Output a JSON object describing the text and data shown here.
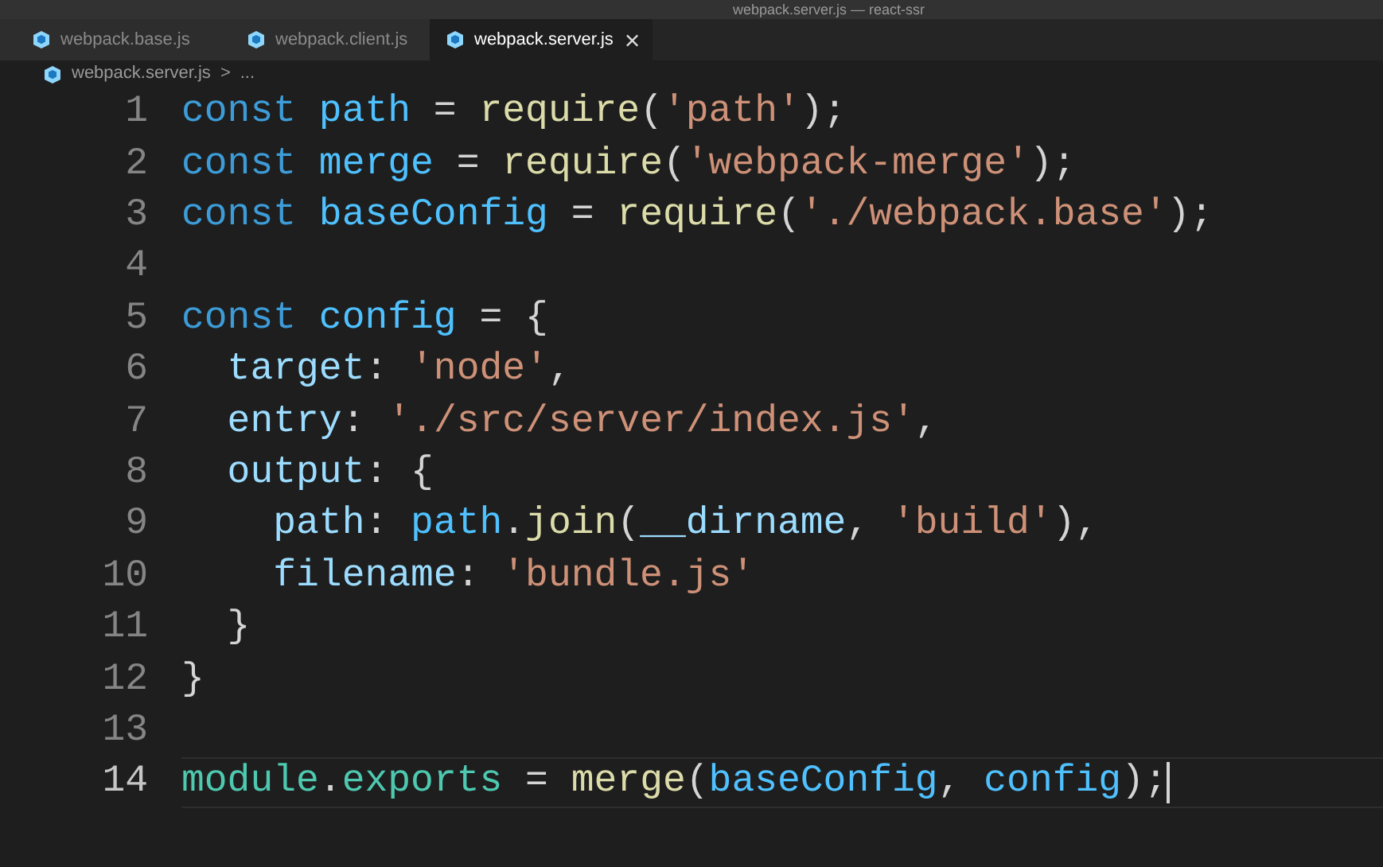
{
  "window": {
    "title": "webpack.server.js — react-ssr"
  },
  "tabs": [
    {
      "label": "webpack.base.js",
      "selected": false
    },
    {
      "label": "webpack.client.js",
      "selected": false
    },
    {
      "label": "webpack.server.js",
      "selected": true
    }
  ],
  "breadcrumb": {
    "file": "webpack.server.js",
    "separator": ">",
    "more": "..."
  },
  "lines": [
    {
      "number": "1",
      "active": false,
      "tokens": [
        {
          "kind": "keyword",
          "text": "const "
        },
        {
          "kind": "variable",
          "text": "path"
        },
        {
          "kind": "plain",
          "text": " = "
        },
        {
          "kind": "function",
          "text": "require"
        },
        {
          "kind": "plain",
          "text": "("
        },
        {
          "kind": "string",
          "text": "'path'"
        },
        {
          "kind": "plain",
          "text": ");"
        }
      ]
    },
    {
      "number": "2",
      "active": false,
      "tokens": [
        {
          "kind": "keyword",
          "text": "const "
        },
        {
          "kind": "variable",
          "text": "merge"
        },
        {
          "kind": "plain",
          "text": " = "
        },
        {
          "kind": "function",
          "text": "require"
        },
        {
          "kind": "plain",
          "text": "("
        },
        {
          "kind": "string",
          "text": "'webpack-merge'"
        },
        {
          "kind": "plain",
          "text": ");"
        }
      ]
    },
    {
      "number": "3",
      "active": false,
      "tokens": [
        {
          "kind": "keyword",
          "text": "const "
        },
        {
          "kind": "variable",
          "text": "baseConfig"
        },
        {
          "kind": "plain",
          "text": " = "
        },
        {
          "kind": "function",
          "text": "require"
        },
        {
          "kind": "plain",
          "text": "("
        },
        {
          "kind": "string",
          "text": "'./webpack.base'"
        },
        {
          "kind": "plain",
          "text": ");"
        }
      ]
    },
    {
      "number": "4",
      "active": false
    },
    {
      "number": "5",
      "active": false,
      "tokens": [
        {
          "kind": "keyword",
          "text": "const "
        },
        {
          "kind": "variable",
          "text": "config"
        },
        {
          "kind": "plain",
          "text": " = {"
        }
      ]
    },
    {
      "number": "6",
      "active": false,
      "tokens": [
        {
          "kind": "property",
          "text": "  target"
        },
        {
          "kind": "plain",
          "text": ": "
        },
        {
          "kind": "string",
          "text": "'node'"
        },
        {
          "kind": "plain",
          "text": ","
        }
      ]
    },
    {
      "number": "7",
      "active": false,
      "tokens": [
        {
          "kind": "property",
          "text": "  entry"
        },
        {
          "kind": "plain",
          "text": ": "
        },
        {
          "kind": "string",
          "text": "'./src/server/index.js'"
        },
        {
          "kind": "plain",
          "text": ","
        }
      ]
    },
    {
      "number": "8",
      "active": false,
      "tokens": [
        {
          "kind": "property",
          "text": "  output"
        },
        {
          "kind": "plain",
          "text": ": {"
        }
      ]
    },
    {
      "number": "9",
      "active": false,
      "tokens": [
        {
          "kind": "property",
          "text": "    path"
        },
        {
          "kind": "plain",
          "text": ": "
        },
        {
          "kind": "variable",
          "text": "path"
        },
        {
          "kind": "plain",
          "text": "."
        },
        {
          "kind": "function",
          "text": "join"
        },
        {
          "kind": "plain",
          "text": "("
        },
        {
          "kind": "property",
          "text": "__dirname"
        },
        {
          "kind": "plain",
          "text": ", "
        },
        {
          "kind": "string",
          "text": "'build'"
        },
        {
          "kind": "plain",
          "text": "),"
        }
      ]
    },
    {
      "number": "10",
      "active": false,
      "tokens": [
        {
          "kind": "property",
          "text": "    filename"
        },
        {
          "kind": "plain",
          "text": ": "
        },
        {
          "kind": "string",
          "text": "'bundle.js'"
        }
      ]
    },
    {
      "number": "11",
      "active": false,
      "tokens": [
        {
          "kind": "plain",
          "text": "  }"
        }
      ]
    },
    {
      "number": "12",
      "active": false,
      "tokens": [
        {
          "kind": "plain",
          "text": "}"
        }
      ]
    },
    {
      "number": "13",
      "active": false
    },
    {
      "number": "14",
      "active": true,
      "tokens": [
        {
          "kind": "module",
          "text": "module"
        },
        {
          "kind": "plain",
          "text": "."
        },
        {
          "kind": "module",
          "text": "exports"
        },
        {
          "kind": "plain",
          "text": " = "
        },
        {
          "kind": "function",
          "text": "merge"
        },
        {
          "kind": "plain",
          "text": "("
        },
        {
          "kind": "variable",
          "text": "baseConfig"
        },
        {
          "kind": "plain",
          "text": ", "
        },
        {
          "kind": "variable",
          "text": "config"
        },
        {
          "kind": "plain",
          "text": ");"
        }
      ]
    }
  ]
}
